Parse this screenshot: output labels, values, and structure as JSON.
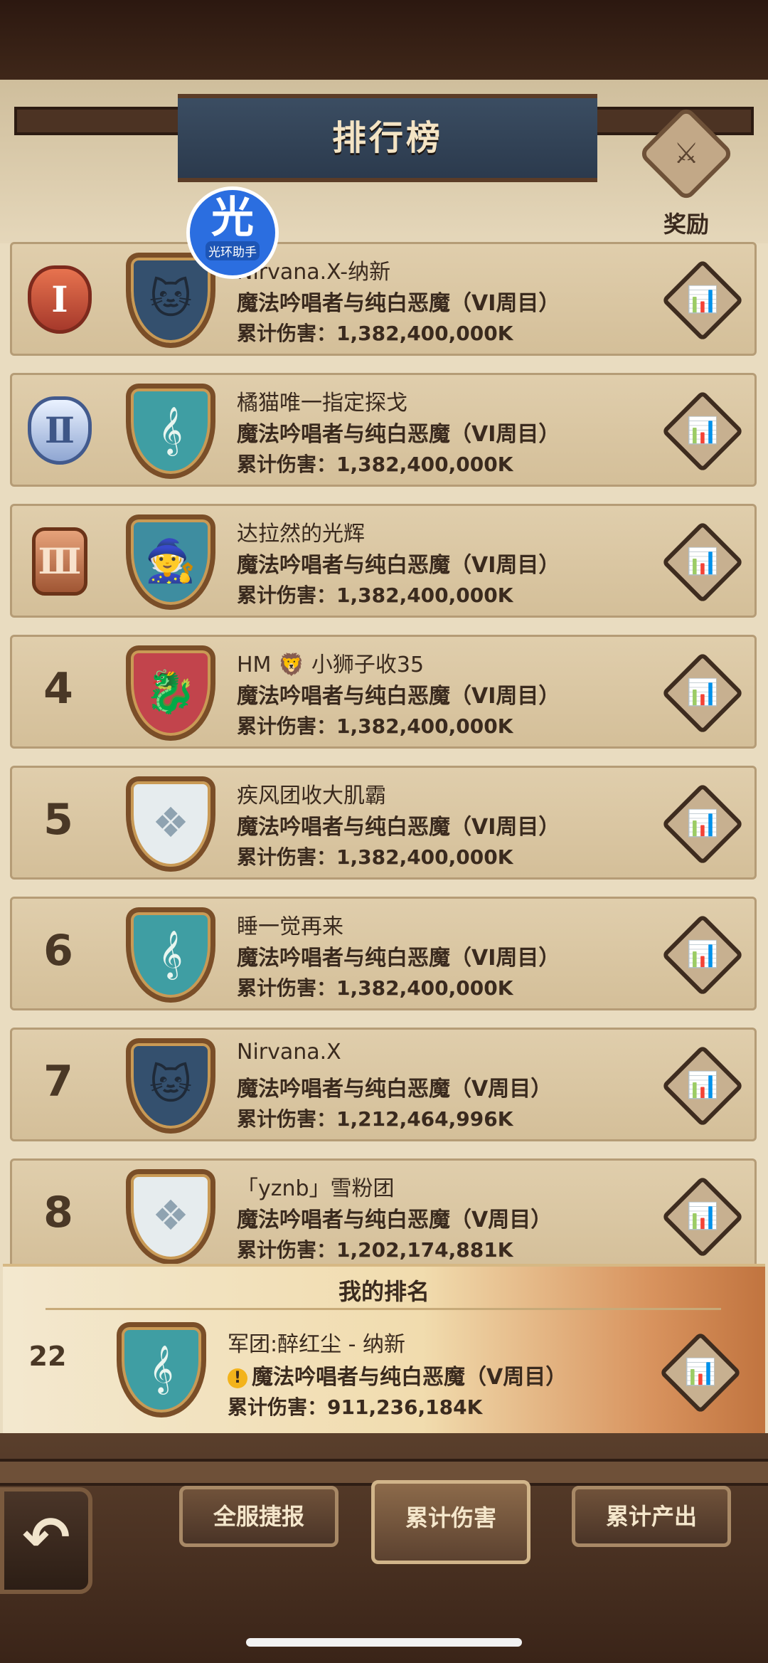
{
  "header": {
    "title": "排行榜",
    "reward_label": "奖励"
  },
  "helper_badge": {
    "glyph": "光",
    "label": "光环助手"
  },
  "rankings": [
    {
      "rank": "1",
      "medal": "Ⅰ",
      "emblem": "cat-emblem",
      "name": "Nirvana.X-纳新",
      "boss": "魔法吟唱者与纯白恶魔（VI周目）",
      "damage": "累计伤害：1,382,400,000K"
    },
    {
      "rank": "2",
      "medal": "Ⅱ",
      "emblem": "harp-emblem",
      "name": "橘猫唯一指定探戈",
      "boss": "魔法吟唱者与纯白恶魔（VI周目）",
      "damage": "累计伤害：1,382,400,000K"
    },
    {
      "rank": "3",
      "medal": "Ⅲ",
      "emblem": "witch-emblem",
      "name": "达拉然的光辉",
      "boss": "魔法吟唱者与纯白恶魔（VI周目）",
      "damage": "累计伤害：1,382,400,000K"
    },
    {
      "rank": "4",
      "emblem": "dragon-emblem",
      "name": "HM 🦁 小狮子收35",
      "boss": "魔法吟唱者与纯白恶魔（VI周目）",
      "damage": "累计伤害：1,382,400,000K"
    },
    {
      "rank": "5",
      "emblem": "wing-emblem",
      "name": "疾风团收大肌霸",
      "boss": "魔法吟唱者与纯白恶魔（VI周目）",
      "damage": "累计伤害：1,382,400,000K"
    },
    {
      "rank": "6",
      "emblem": "harp-emblem",
      "name": "睡一觉再来",
      "boss": "魔法吟唱者与纯白恶魔（VI周目）",
      "damage": "累计伤害：1,382,400,000K"
    },
    {
      "rank": "7",
      "emblem": "cat-emblem",
      "name": "Nirvana.X",
      "boss": "魔法吟唱者与纯白恶魔（V周目）",
      "damage": "累计伤害：1,212,464,996K"
    },
    {
      "rank": "8",
      "emblem": "wing-emblem",
      "name": "「yznb」雪粉团",
      "boss": "魔法吟唱者与纯白恶魔（V周目）",
      "damage": "累计伤害：1,202,174,881K"
    }
  ],
  "my_rank": {
    "header": "我的排名",
    "rank": "22",
    "emblem": "harp-emblem",
    "name": "军团:醉红尘 - 纳新",
    "warning_icon": "!",
    "boss": "魔法吟唱者与纯白恶魔（V周目）",
    "damage": "累计伤害：911,236,184K"
  },
  "tabs": [
    {
      "label": "全服捷报",
      "active": false
    },
    {
      "label": "累计伤害",
      "active": true
    },
    {
      "label": "累计产出",
      "active": false
    }
  ],
  "icons": {
    "stats": "📊",
    "back": "↶",
    "reward": "⚔",
    "cat": "🐱",
    "harp": "𝄞",
    "witch": "🧙",
    "dragon": "🐉",
    "wing": "❖"
  }
}
